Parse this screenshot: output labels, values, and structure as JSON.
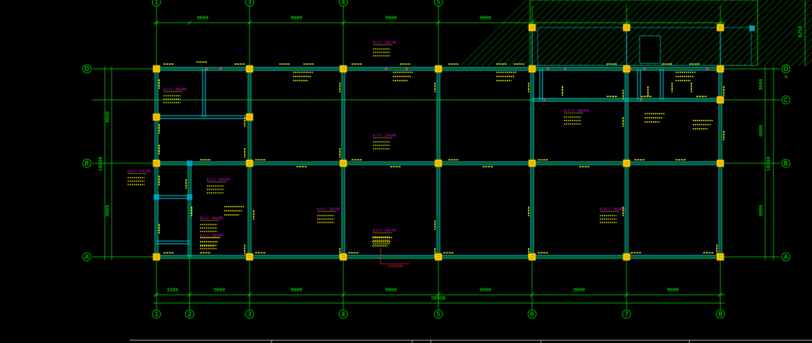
{
  "colors": {
    "background": "#000000",
    "dimension": "#00ff00",
    "beam": "#00e5ff",
    "column": "#ffd400",
    "annotation": "#ffff00",
    "beam_label": "#ff00ff",
    "hatch": "#00c000",
    "marker": "#ff2020"
  },
  "grid": {
    "columns": [
      "1",
      "2",
      "3",
      "4",
      "5",
      "6",
      "7",
      "8"
    ],
    "rows": [
      "A",
      "B",
      "C",
      "D"
    ]
  },
  "dimensions": {
    "top": [
      "9000",
      "9000",
      "9000",
      "9000"
    ],
    "bottom": [
      "3200",
      "5800",
      "9000",
      "9000",
      "9000",
      "9000",
      "9000"
    ],
    "total": "56400",
    "left": [
      "9000",
      "9000"
    ],
    "left_total": "18000",
    "right": [
      "9000",
      "6000",
      "3000"
    ],
    "right_top": "6250"
  },
  "texts": {
    "b_2x": "2x",
    "red_tag": "XXXXXXXXX"
  },
  "beam_labels": [
    {
      "text": "KL2(1) 300x600"
    },
    {
      "text": "KL1(1) 300x700"
    },
    {
      "text": "KL3(2) 300x600"
    },
    {
      "text": "KL4(1) 250x500"
    },
    {
      "text": "KL5(1) 300x600"
    },
    {
      "text": "KL6(1) 300x600"
    },
    {
      "text": "KL7(1) 250x600"
    },
    {
      "text": "KL8(1) 300x600"
    },
    {
      "text": "KL9(2) 300x700"
    },
    {
      "text": "KL10(1) 300x600"
    },
    {
      "text": "KL11(1) 300x600"
    }
  ]
}
